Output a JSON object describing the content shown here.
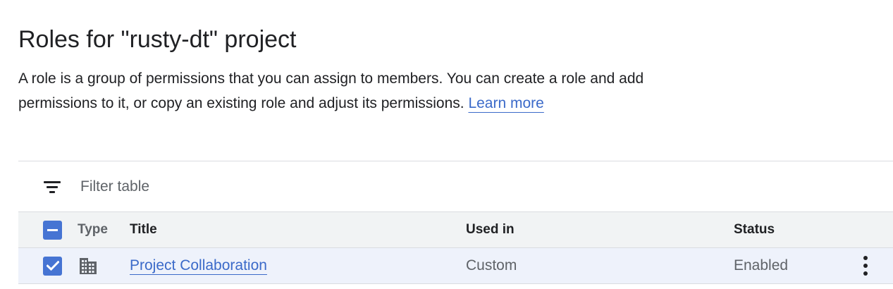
{
  "page": {
    "title": "Roles for \"rusty-dt\" project",
    "description": "A role is a group of permissions that you can assign to members. You can create a role and add permissions to it, or copy an existing role and adjust its permissions. ",
    "learn_more": "Learn more"
  },
  "filter": {
    "placeholder": "Filter table",
    "icon": "filter-icon"
  },
  "table": {
    "columns": {
      "type": "Type",
      "title": "Title",
      "used_in": "Used in",
      "status": "Status"
    },
    "rows": [
      {
        "selected": true,
        "type_icon": "building-icon",
        "title": "Project Collaboration",
        "used_in": "Custom",
        "status": "Enabled"
      }
    ]
  },
  "colors": {
    "accent": "#4674d3",
    "link": "#3b6ac9",
    "header_bg": "#f1f3f4",
    "selected_row_bg": "#eef2fb",
    "border": "#dadce0"
  }
}
